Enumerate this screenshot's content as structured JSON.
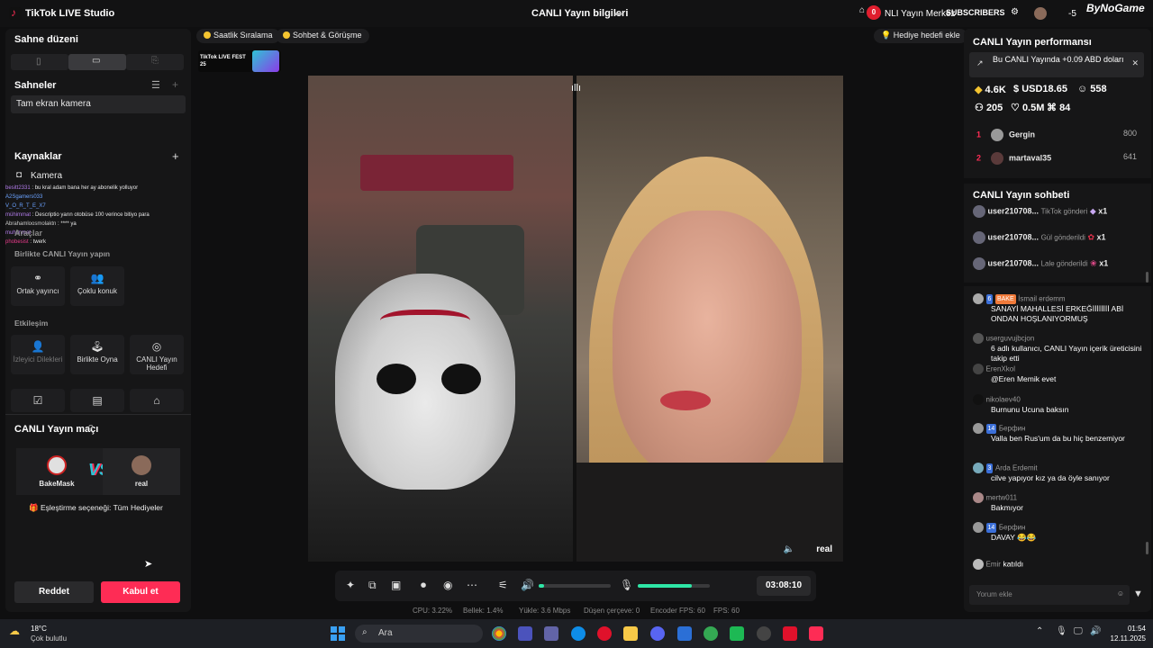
{
  "titlebar": {
    "app_title": "TikTok LIVE Studio",
    "center_title": "CANLI Yayın bilgileri",
    "live_center_label": "NLI Yayın Merkez",
    "notif_count": "0",
    "subscribers_label": "SUBSCRIBERS",
    "right_number": "-5",
    "watermark": "ByNoGame"
  },
  "left": {
    "scene_layout_title": "Sahne düzeni",
    "scenes_title": "Sahneler",
    "scene_item": "Tam ekran kamera",
    "sources_title": "Kaynaklar",
    "source_item": "Kamera",
    "tools_title": "Araçlar",
    "live_together_title": "Birlikte CANLI Yayın yapın",
    "cohost_label": "Ortak yayıncı",
    "multi_guest_label": "Çoklu konuk",
    "interaction_title": "Etkileşim",
    "viewer_requests_label": "İzleyici Dilekleri",
    "play_together_label": "Birlikte Oyna",
    "live_goal_label": "CANLI Yayın Hedefi",
    "overlay_chat": [
      {
        "user": "besitt2331",
        "msg": "bu kral adam bana her ay abonelik yolluyor"
      },
      {
        "user": "A2Sgamers033",
        "msg": ""
      },
      {
        "user": "V_O_R_T_E_X7",
        "msg": ""
      },
      {
        "user": "mühimmat",
        "msg": "Descriptio yarın otobüse 100 verince bitiyo para"
      },
      {
        "user": "Abrahamloosmolaktn",
        "msg": "**** ya"
      },
      {
        "user": "muhimmat",
        "msg": ""
      },
      {
        "user": "phobesist",
        "msg": "twerk"
      }
    ],
    "match_title": "CANLI Yayın maçı",
    "player1": "BakeMask",
    "player2": "real",
    "vs": "VS",
    "match_option": "Eşleştirme seçeneği: Tüm Hediyeler",
    "reject_label": "Reddet",
    "accept_label": "Kabul et"
  },
  "center": {
    "pill1": "Saatlik Sıralama",
    "pill2": "Sohbet & Görüşme",
    "pill3": "Hediye hedefi ekle",
    "fest_label": "TikTok LIVE FEST 25",
    "real_tag": "real",
    "timer": "03:08:10",
    "volume_level": 0.08,
    "mic_level": 0.75,
    "stats": {
      "cpu": "CPU: 3.22%",
      "mem": "Bellek: 1.4%",
      "upload": "Yükle: 3.6 Mbps",
      "dropped": "Düşen çerçeve: 0",
      "encoder": "Encoder FPS: 60",
      "fps": "FPS: 60"
    }
  },
  "right": {
    "perf_title": "CANLI Yayın performansı",
    "earnings": "Bu CANLI Yayında +0.09 ABD doları",
    "m_diamonds": "4.6K",
    "m_usd": "USD18.65",
    "m_viewers": "558",
    "m_new": "205",
    "m_likes": "0.5M",
    "m_gifts": "84",
    "ranking": [
      {
        "rank": "1",
        "name": "Gergin",
        "score": "800"
      },
      {
        "rank": "2",
        "name": "martaval35",
        "score": "641"
      }
    ],
    "chat_title": "CANLI Yayın sohbeti",
    "gifts": [
      {
        "user": "user210708...",
        "action": "TikTok gönderi",
        "count": "x1"
      },
      {
        "user": "user210708...",
        "action": "Gül gönderildi",
        "count": "x1"
      },
      {
        "user": "user210708...",
        "action": "Lale gönderildi",
        "count": "x1"
      }
    ],
    "chats": [
      {
        "badge": "6",
        "badge2": "BAKE",
        "user": "İsmail erdemm",
        "msg": "SANAYİ MAHALLESİ ERKEĞİİİİİİİİ ABİ ONDAN HOŞLANIYORMUŞ"
      },
      {
        "badge": "",
        "badge2": "",
        "user": "userguvujbcjon",
        "msg": "6 adlı kullanıcı, CANLI Yayın içerik üreticisini takip etti"
      },
      {
        "badge": "",
        "badge2": "",
        "user": "ErenXkol",
        "msg": "@Eren Memik evet"
      },
      {
        "badge": "",
        "badge2": "",
        "user": "nikolaev40",
        "msg": "Burnunu Ucuna baksın"
      },
      {
        "badge": "14",
        "badge2": "",
        "user": "Берфин",
        "msg": "Valla ben Rus'um da bu hiç benzemiyor"
      },
      {
        "badge": "3",
        "badge2": "",
        "user": "Arda Erdemit",
        "msg": "cilve yapıyor kız ya da öyle sanıyor"
      },
      {
        "badge": "",
        "badge2": "",
        "user": "mertw011",
        "msg": "Bakmıyor"
      },
      {
        "badge": "14",
        "badge2": "",
        "user": "Берфин",
        "msg": "DAVAY 😂😂"
      },
      {
        "badge": "",
        "badge2": "",
        "user": "Emir",
        "msg": "katıldı"
      }
    ],
    "comment_placeholder": "Yorum ekle"
  },
  "taskbar": {
    "weather_temp": "18°C",
    "weather_desc": "Çok bulutlu",
    "search_label": "Ara",
    "time": "01:54",
    "date": "12.11.2025"
  }
}
